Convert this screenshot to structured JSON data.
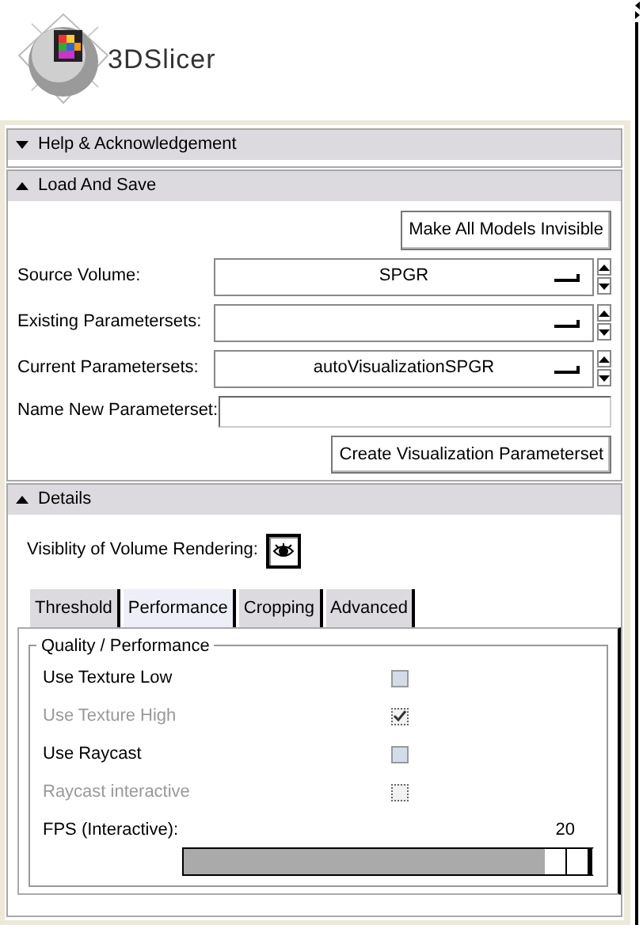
{
  "logo": {
    "text": "3DSlicer"
  },
  "sections": [
    {
      "kind": "help",
      "title": "Help & Acknowledgement",
      "expanded": false
    },
    {
      "kind": "load",
      "title": "Load And Save",
      "expanded": true
    },
    {
      "kind": "details",
      "title": "Details",
      "expanded": true
    }
  ],
  "load_and_save": {
    "top_button": "Make All Models Invisible",
    "selectors": [
      {
        "label": "Source Volume:",
        "value": "SPGR"
      },
      {
        "label": "Existing Parametersets:"
      },
      {
        "label": "Current Parametersets:",
        "value": "autoVisualizationSPGR"
      }
    ],
    "name_field": {
      "label": "Name New Parameterset:"
    },
    "create_button": "Create Visualization Parameterset"
  },
  "details": {
    "visibility": {
      "label": "Visiblity of Volume Rendering:",
      "on": true
    },
    "tabs": [
      {
        "label": "Threshold",
        "selected": false
      },
      {
        "label": "Performance",
        "selected": true
      },
      {
        "label": "Cropping",
        "selected": false
      },
      {
        "label": "Advanced",
        "selected": false
      }
    ],
    "group": {
      "title": "Quality / Performance",
      "options": [
        {
          "label": "Use Texture Low",
          "checked": false,
          "disabled": false
        },
        {
          "label": "Use Texture High",
          "checked": true,
          "disabled": true
        },
        {
          "label": "Use Raycast",
          "checked": false,
          "disabled": false
        },
        {
          "label": "Raycast interactive",
          "checked": false,
          "disabled": true
        }
      ],
      "slider": {
        "label": "FPS (Interactive):",
        "reading": "20",
        "level": 1
      }
    }
  }
}
